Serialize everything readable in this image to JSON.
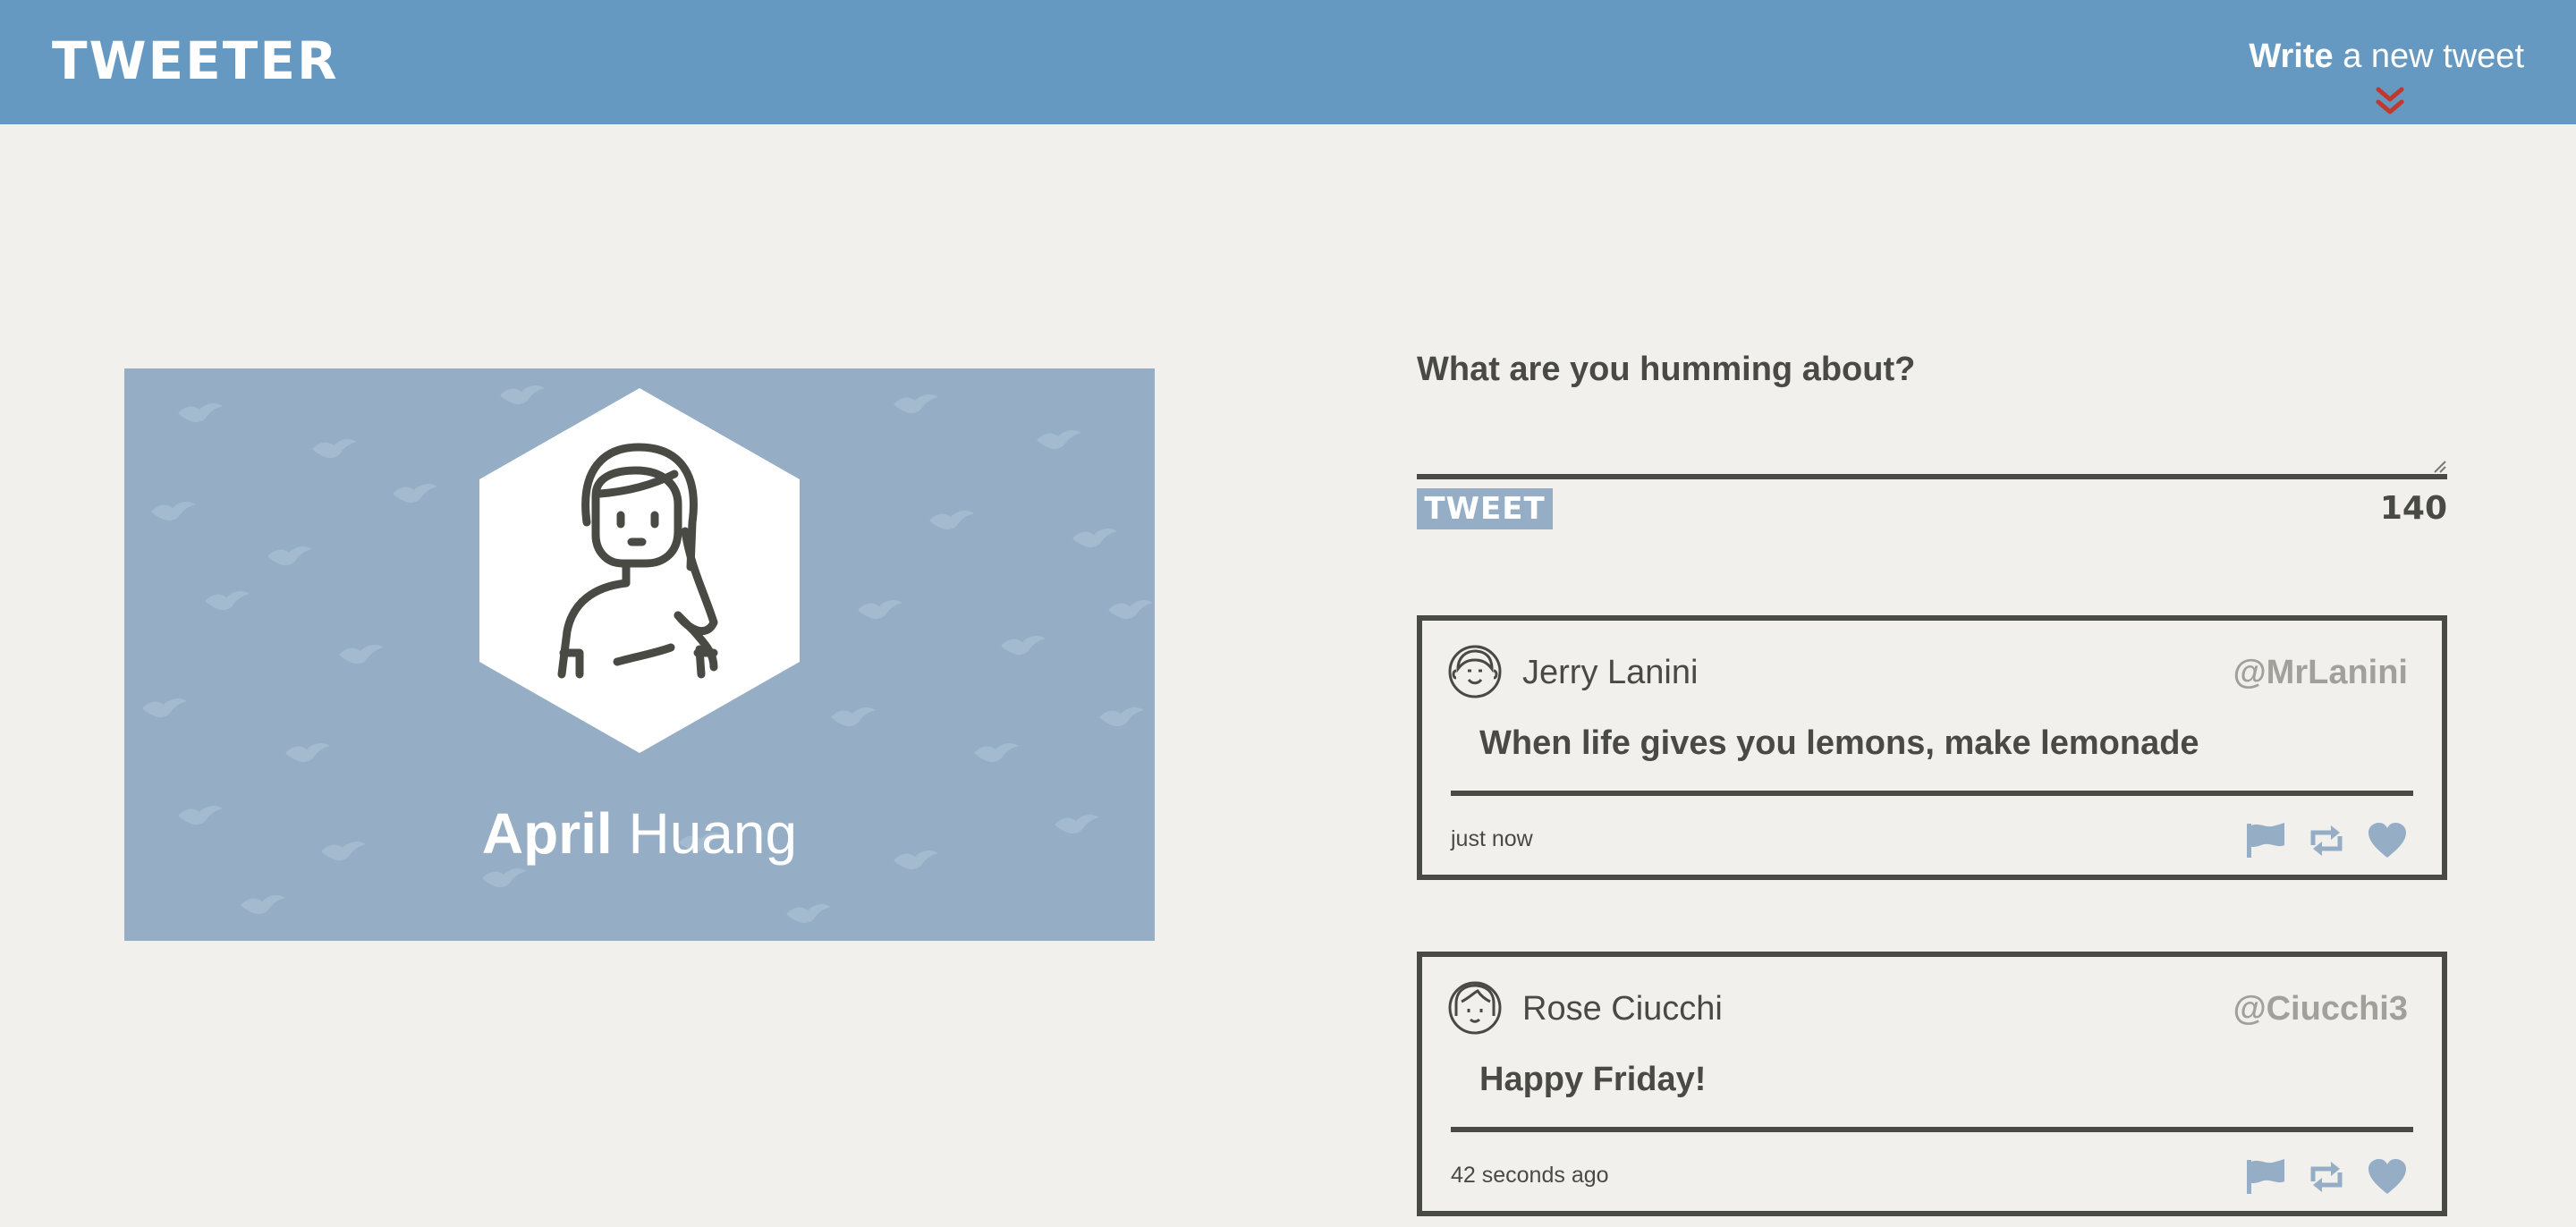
{
  "nav": {
    "logo": "TWEETER",
    "compose_bold": "Write",
    "compose_rest": " a new tweet"
  },
  "profile": {
    "first_name": "April",
    "last_name": "Huang"
  },
  "compose": {
    "heading": "What are you humming about?",
    "textarea_value": "",
    "button_label": "TWEET",
    "counter": "140"
  },
  "tweets": [
    {
      "name": "Jerry Lanini",
      "handle": "@MrLanini",
      "content": "When life gives you lemons, make lemonade",
      "time": "just now",
      "avatar_icon": "man-avatar-icon"
    },
    {
      "name": "Rose Ciucchi",
      "handle": "@Ciucchi3",
      "content": "Happy Friday!",
      "time": "42 seconds ago",
      "avatar_icon": "woman-avatar-icon"
    }
  ],
  "icons": {
    "flag": "flag-icon",
    "retweet": "retweet-icon",
    "like": "heart-icon"
  },
  "colors": {
    "nav": "#6699c1",
    "background": "#f1f0ec",
    "accent": "#95aec6",
    "text": "#4a4a44",
    "handle": "#a2a09a",
    "chevron": "#c0392b"
  }
}
